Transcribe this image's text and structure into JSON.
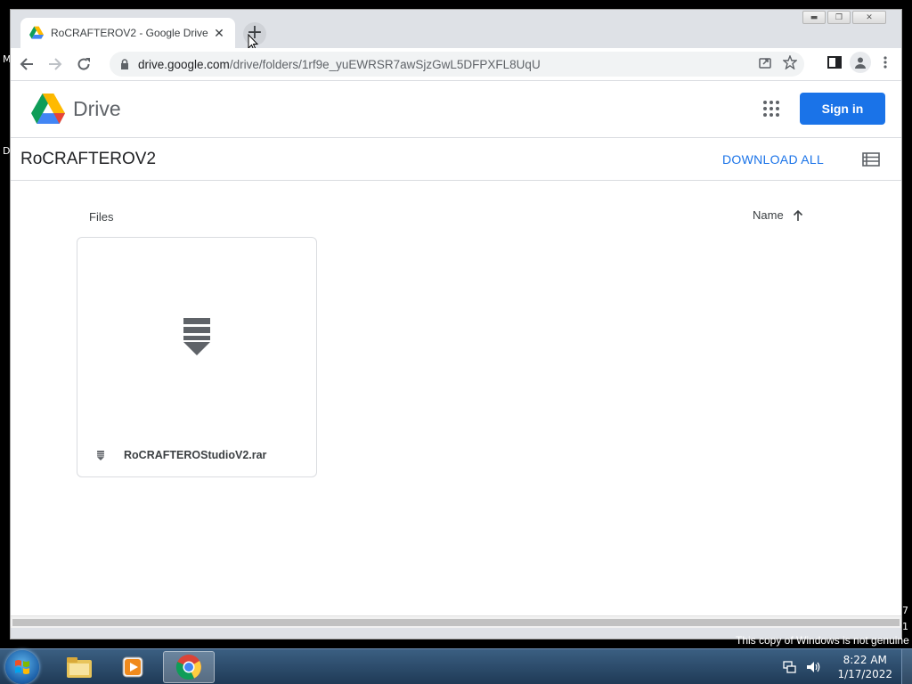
{
  "desktop": {
    "left_letters": [
      "M",
      "D"
    ],
    "right_digits": [
      "7",
      "1"
    ],
    "watermark": "This copy of Windows is not genuine"
  },
  "browser": {
    "window_controls": [
      "minimize-icon",
      "restore-icon",
      "close-icon"
    ],
    "tab": {
      "title": "RoCRAFTEROV2 - Google Drive",
      "favicon": "google-drive-icon",
      "close_icon": "close-icon"
    },
    "new_tab_symbol": "+",
    "toolbar": {
      "back_icon": "arrow-left-icon",
      "forward_icon": "arrow-right-icon",
      "reload_icon": "reload-icon",
      "url_host": "drive.google.com",
      "url_path": "/drive/folders/1rf9e_yuEWRSR7awSjzGwL5DFPXFL8UqU"
    }
  },
  "drive": {
    "brand": "Drive",
    "sign_in_label": "Sign in",
    "folder_name": "RoCRAFTEROV2",
    "download_all_label": "DOWNLOAD ALL",
    "files_label": "Files",
    "sort_label": "Name",
    "sort_direction": "ascending",
    "files": [
      {
        "name": "RoCRAFTEROStudioV2.rar",
        "icon": "archive-file-icon"
      }
    ]
  },
  "taskbar": {
    "apps": [
      "windows-explorer-icon",
      "media-player-icon",
      "chrome-icon"
    ],
    "active_app": "chrome-icon",
    "time": "8:22 AM",
    "date": "1/17/2022"
  },
  "colors": {
    "accent_blue": "#1a73e8",
    "text_dark": "#202124",
    "text_muted": "#5f6368"
  }
}
